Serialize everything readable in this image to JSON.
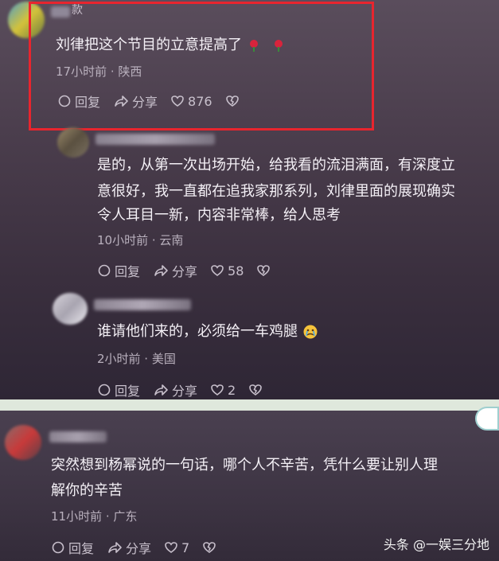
{
  "comments": [
    {
      "name_fragment": "款",
      "text": "刘律把这个节目的立意提高了",
      "time_location": "17小时前 · 陕西",
      "reply_label": "回复",
      "share_label": "分享",
      "likes": "876"
    },
    {
      "lines": [
        "是的，从第一次出场开始，给我看的流泪满面，有深度立",
        "意很好，我一直都在追我家那系列，刘律里面的展现确实",
        "令人耳目一新，内容非常棒，给人思考"
      ],
      "time_location": "10小时前 · 云南",
      "reply_label": "回复",
      "share_label": "分享",
      "likes": "58"
    },
    {
      "text": "谁请他们来的，必须给一车鸡腿",
      "time_location": "2小时前 · 美国",
      "reply_label": "回复",
      "share_label": "分享",
      "likes": "2"
    },
    {
      "lines": [
        "突然想到杨幂说的一句话，哪个人不辛苦，凭什么要让别人理",
        "解你的辛苦"
      ],
      "time_location": "11小时前 · 广东",
      "reply_label": "回复",
      "share_label": "分享",
      "likes": "7"
    }
  ],
  "watermark": "头条 @一娱三分地",
  "colors": {
    "highlight": "#e8252e",
    "text": "#f4f0f6",
    "meta": "#b9b0bd"
  }
}
